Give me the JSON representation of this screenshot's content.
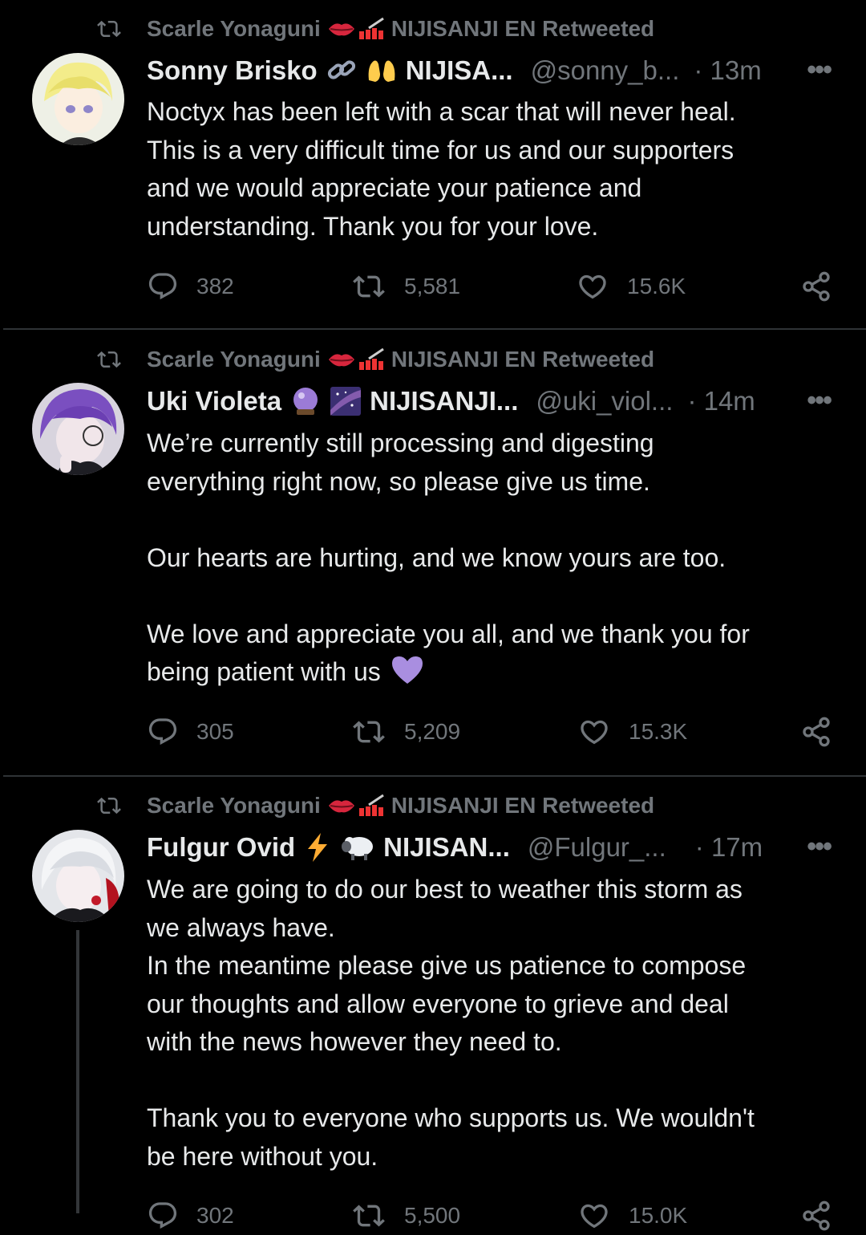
{
  "tweets": [
    {
      "retweeter": "Scarle Yonaguni",
      "retweeted_label": "NIJISANJI EN Retweeted",
      "name": "Sonny Brisko",
      "org": "NIJISA...",
      "handle": "@sonny_b...",
      "time": "· 13m",
      "text": "Noctyx has been left with a scar that will never heal.\nThis is a very difficult time for us and our supporters\nand we would appreciate your patience and\nunderstanding. Thank you for your love.",
      "replies": "382",
      "retweets": "5,581",
      "likes": "15.6K"
    },
    {
      "retweeter": "Scarle Yonaguni",
      "retweeted_label": "NIJISANJI EN Retweeted",
      "name": "Uki Violeta",
      "org": "NIJISANJI...",
      "handle": "@uki_viol...",
      "time": "· 14m",
      "text": "We’re currently still processing and digesting\neverything right now, so please give us time.\n\nOur hearts are hurting, and we know yours are too.\n\nWe love and appreciate you all, and we thank you for\nbeing patient with us",
      "replies": "305",
      "retweets": "5,209",
      "likes": "15.3K"
    },
    {
      "retweeter": "Scarle Yonaguni",
      "retweeted_label": "NIJISANJI EN Retweeted",
      "name": "Fulgur Ovid",
      "org": "NIJISAN...",
      "handle": "@Fulgur_...",
      "time": "· 17m",
      "text": "We are going to do our best to weather this storm as\nwe always have.\nIn the meantime please give us patience to compose\nour thoughts and allow everyone to grieve and deal\nwith the news however they need to.\n\nThank you to everyone who supports us. We wouldn't\nbe here without you.",
      "replies": "302",
      "retweets": "5,500",
      "likes": "15.0K"
    }
  ],
  "icons": {
    "retweet": "retweet-icon",
    "more": "more-icon",
    "reply": "reply-icon",
    "like": "heart-icon",
    "share": "share-icon"
  },
  "colors": {
    "background": "#000000",
    "text": "#e7e9ea",
    "muted": "#71767b",
    "divider": "#2f3336",
    "purple_heart": "#a98ee0"
  }
}
